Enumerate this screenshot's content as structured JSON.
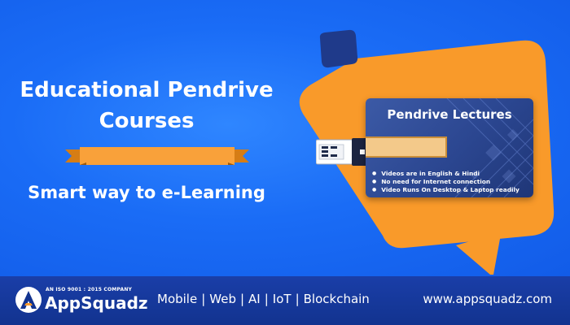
{
  "banner": {
    "headline_line1": "Educational Pendrive",
    "headline_line2": "Courses",
    "tagline": "Smart way to e-Learning",
    "colors": {
      "background": "#1a6cf6",
      "accent_orange": "#f99a2a",
      "navy": "#1f3a8a"
    }
  },
  "card": {
    "title": "Pendrive Lectures",
    "features": [
      "Videos are in English & Hindi",
      "No need for Internet connection",
      "Video Runs On Desktop & Laptop readily"
    ]
  },
  "footer": {
    "logo": {
      "icon": "appsquadz-a-logo-icon",
      "certification": "AN ISO 9001 : 2015 COMPANY",
      "name": "AppSquadz"
    },
    "services": [
      "Mobile",
      "Web",
      "AI",
      "IoT",
      "Blockchain"
    ],
    "website": "www.appsquadz.com"
  }
}
